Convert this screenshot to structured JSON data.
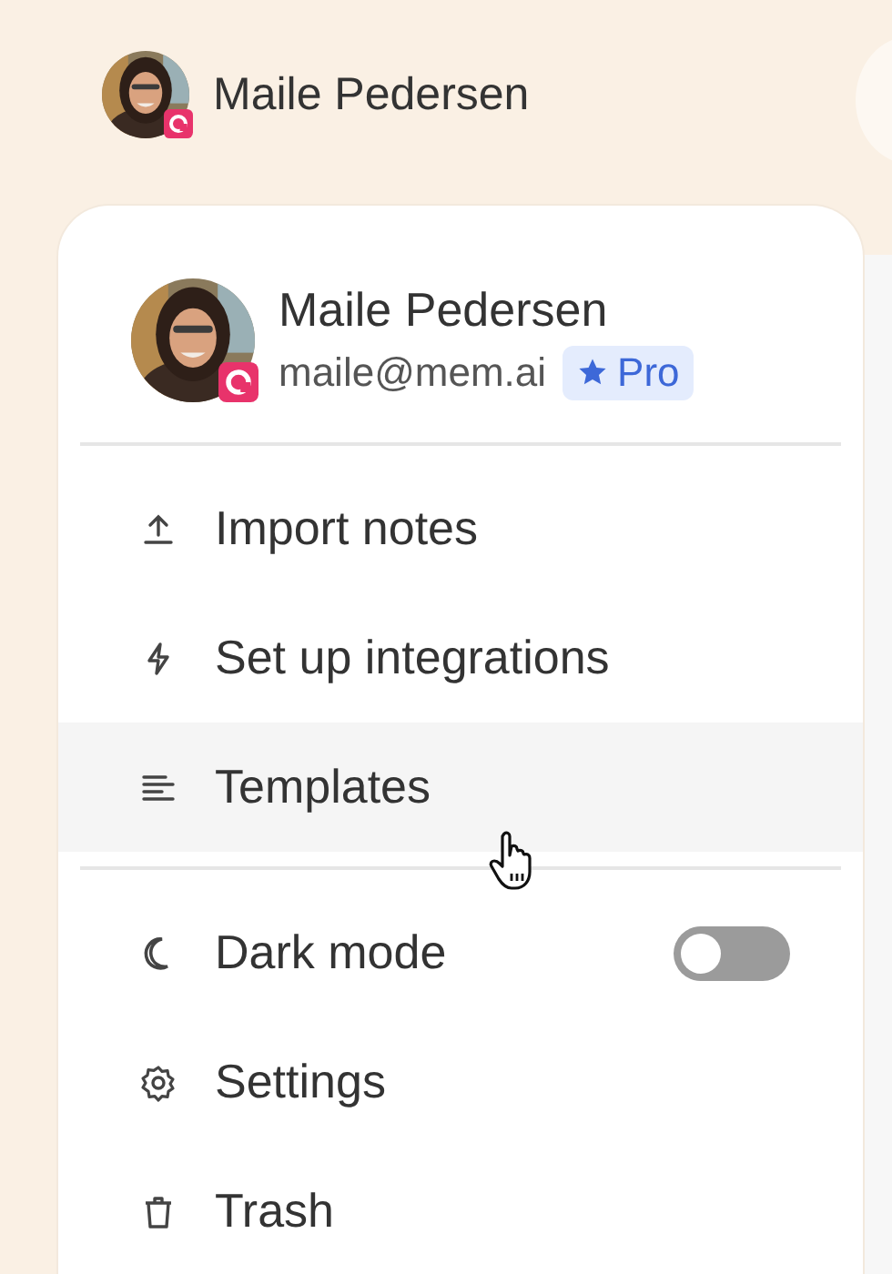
{
  "top_user": {
    "name": "Maile Pedersen"
  },
  "menu": {
    "header": {
      "name": "Maile Pedersen",
      "email": "maile@mem.ai",
      "badge": "Pro"
    },
    "sections": [
      {
        "items": [
          {
            "kind": "action",
            "label": "Import notes",
            "hovered": false
          },
          {
            "kind": "action",
            "label": "Set up integrations",
            "hovered": false
          },
          {
            "kind": "action",
            "label": "Templates",
            "hovered": true
          }
        ]
      },
      {
        "items": [
          {
            "kind": "toggle",
            "label": "Dark mode",
            "hovered": false,
            "on": false
          },
          {
            "kind": "action",
            "label": "Settings",
            "hovered": false
          },
          {
            "kind": "action",
            "label": "Trash",
            "hovered": false
          }
        ]
      }
    ]
  }
}
